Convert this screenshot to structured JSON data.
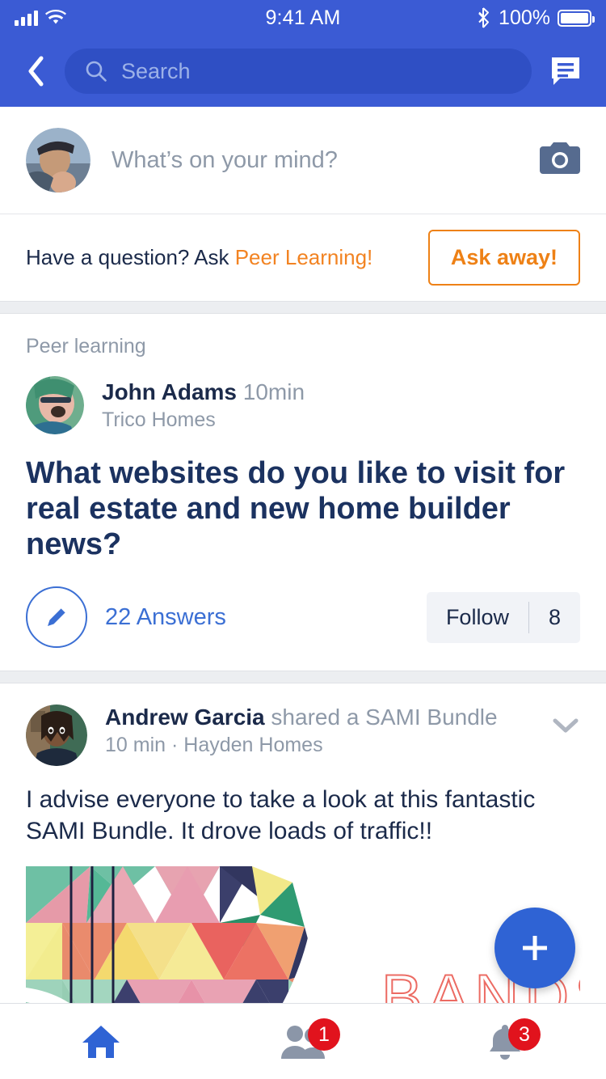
{
  "statusbar": {
    "time": "9:41 AM",
    "battery_percent": "100%",
    "signal_icon": "cellular-signal-icon",
    "wifi_icon": "wifi-icon",
    "bluetooth_icon": "bluetooth-icon",
    "battery_icon": "battery-full-icon"
  },
  "navbar": {
    "back_icon": "back-chevron-icon",
    "search_placeholder": "Search",
    "search_value": "",
    "search_icon": "search-icon",
    "messages_icon": "messages-icon"
  },
  "composer": {
    "placeholder": "What’s on your mind?",
    "avatar_name": "user-avatar",
    "camera_icon": "camera-icon"
  },
  "ask_strip": {
    "prefix": "Have a question? Ask ",
    "link": "Peer Learning!",
    "button_label": "Ask away!",
    "link_color": "#f28322",
    "button_color": "#ee8116"
  },
  "question_post": {
    "kicker": "Peer learning",
    "author": "John Adams",
    "time": "10min",
    "company": "Trico Homes",
    "question": "What websites do you like to visit for real estate and new home builder news?",
    "answers_count": "22",
    "answers_label": "Answers",
    "answers_text": "22  Answers",
    "follow_label": "Follow",
    "follow_count": "8",
    "pencil_icon": "pencil-icon",
    "accent_color": "#3b6fd4"
  },
  "share_post": {
    "author": "Andrew Garcia",
    "action": "shared a SAMI Bundle",
    "time": "10 min",
    "separator": "·",
    "company": "Hayden Homes",
    "body": "I advise everyone to take a look at this fantastic SAMI Bundle.  It drove loads of traffic!!",
    "chevron_icon": "chevron-down-icon",
    "attachment_text": "BANDS",
    "attachment_name": "bands-geometric-artwork"
  },
  "fab": {
    "icon": "plus-icon",
    "color": "#2f63d4"
  },
  "bottomnav": {
    "items": [
      {
        "icon": "home-icon",
        "name": "home",
        "badge": "",
        "active": true
      },
      {
        "icon": "friends-icon",
        "name": "friends",
        "badge": "1",
        "active": false
      },
      {
        "icon": "bell-icon",
        "name": "notifications",
        "badge": "3",
        "active": false
      }
    ]
  },
  "theme": {
    "header_blue": "#3b5bd4",
    "search_blue": "#2f4fc4",
    "badge_red": "#e1131d"
  }
}
